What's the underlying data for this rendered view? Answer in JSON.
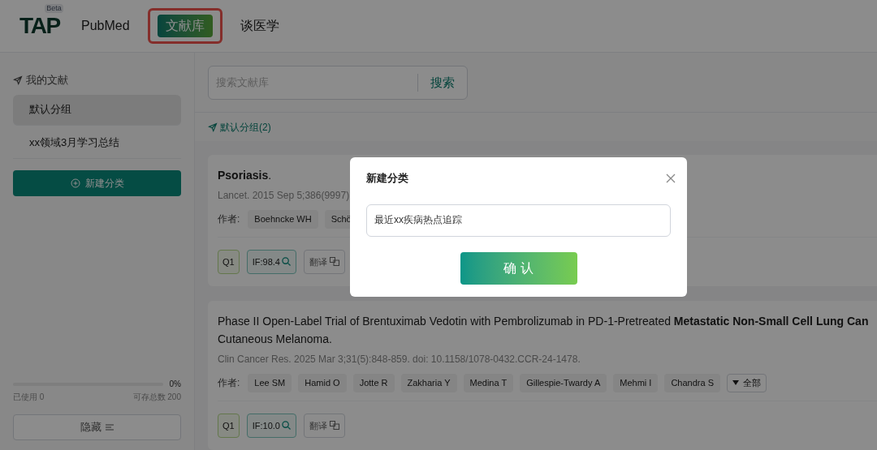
{
  "logo": {
    "text": "TAP",
    "badge": "Beta"
  },
  "nav": [
    {
      "label": "PubMed",
      "selected": false,
      "highlighted": false
    },
    {
      "label": "文献库",
      "selected": true,
      "highlighted": true
    },
    {
      "label": "谈医学",
      "selected": false,
      "highlighted": false
    }
  ],
  "sidebar": {
    "heading": "我的文献",
    "groups": [
      {
        "label": "默认分组",
        "selected": true
      },
      {
        "label": "xx领域3月学习总结",
        "selected": false
      }
    ],
    "new_button": "新建分类",
    "usage": {
      "level": 0,
      "percent": "0%",
      "used": "已使用 0",
      "total": "可存总数 200"
    },
    "hide_button": "隐藏"
  },
  "search": {
    "placeholder": "搜索文献库",
    "button": "搜索"
  },
  "group_title": "默认分组(2)",
  "articles": [
    {
      "title_lines": [
        "**Psoriasis**."
      ],
      "citation": "Lancet. 2015 Sep 5;386(9997)",
      "authors_label": "作者:",
      "authors": [
        "Boehncke WH",
        "Schö"
      ],
      "quartile": "Q1",
      "impact": "IF:98.4",
      "translate": "翻译"
    },
    {
      "title_lines": [
        "Phase II Open-Label Trial of Brentuximab Vedotin with Pembrolizumab in PD-1-Pretreated **Metastatic Non-Small Cell Lung Can**",
        "Cutaneous Melanoma."
      ],
      "citation": "Clin Cancer Res. 2025 Mar 3;31(5):848-859. doi: 10.1158/1078-0432.CCR-24-1478.",
      "authors_label": "作者:",
      "authors": [
        "Lee SM",
        "Hamid O",
        "Jotte R",
        "Zakharia Y",
        "Medina T",
        "Gillespie-Twardy A",
        "Mehmi I",
        "Chandra S"
      ],
      "more_authors": "全部",
      "quartile": "Q1",
      "impact": "IF:10.0",
      "translate": "翻译"
    }
  ],
  "dialog": {
    "title": "新建分类",
    "value": "最近xx疾病热点追踪",
    "confirm": "确 认"
  }
}
